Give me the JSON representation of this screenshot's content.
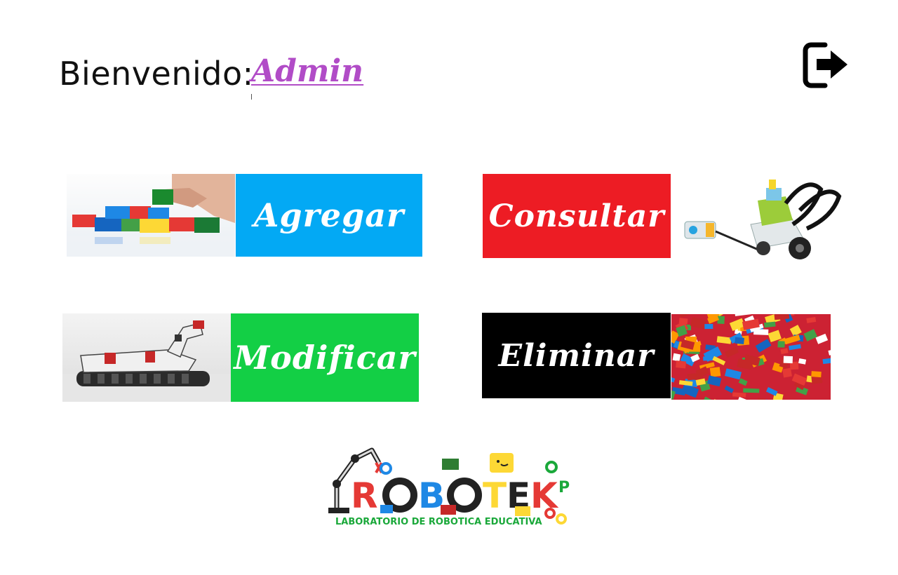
{
  "header": {
    "welcome_label": "Bienvenido:",
    "username": "Admin",
    "username_color": "#b14cc7",
    "logout_icon": "logout-icon"
  },
  "actions": [
    {
      "label": "Agregar",
      "color": "#03a9f4",
      "image": "lego-bricks-hand-photo"
    },
    {
      "label": "Consultar",
      "color": "#ed1c24",
      "image": "lego-wedo-robot-photo"
    },
    {
      "label": "Modificar",
      "color": "#13cf45",
      "image": "lego-mindstorms-robot-photo"
    },
    {
      "label": "Eliminar",
      "color": "#000000",
      "image": "lego-bricks-pile-photo"
    }
  ],
  "logo": {
    "brand": "ROBOTEK",
    "suffix": "P",
    "tagline": "LABORATORIO DE ROBOTICA EDUCATIVA",
    "tagline_color": "#1aa83a"
  }
}
